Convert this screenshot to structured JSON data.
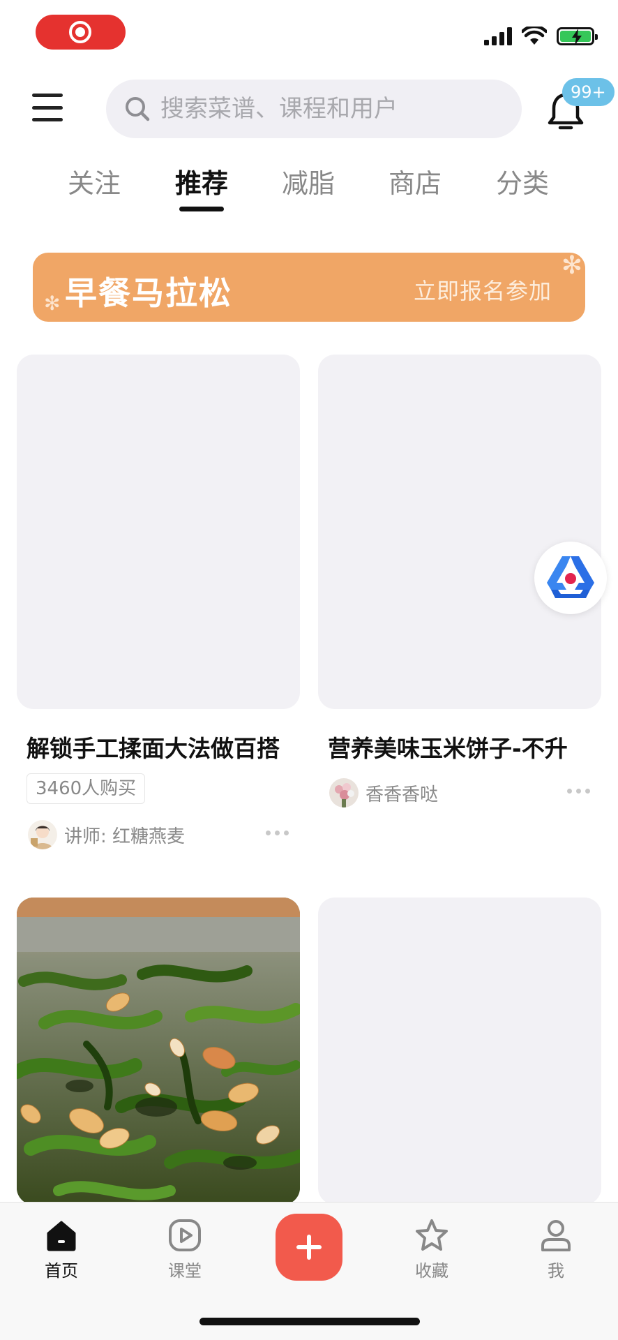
{
  "header": {
    "search_placeholder": "搜索菜谱、课程和用户",
    "notification_badge": "99+"
  },
  "tabs": [
    {
      "label": "关注",
      "active": false
    },
    {
      "label": "推荐",
      "active": true
    },
    {
      "label": "减脂",
      "active": false
    },
    {
      "label": "商店",
      "active": false
    },
    {
      "label": "分类",
      "active": false
    }
  ],
  "banner": {
    "title": "早餐马拉松",
    "cta": "立即报名参加"
  },
  "cards": [
    {
      "title": "解锁手工揉面大法做百搭",
      "tag": "3460人购买",
      "meta": "讲师: 红糖燕麦",
      "image": "placeholder"
    },
    {
      "title": "营养美味玉米饼子-不升",
      "meta": "香香香哒",
      "image": "placeholder"
    },
    {
      "title": "",
      "image": "stir-fried-green-peppers-photo"
    },
    {
      "title": "",
      "image": "placeholder"
    }
  ],
  "tabbar": {
    "items": [
      {
        "label": "首页",
        "icon": "home-icon",
        "active": true
      },
      {
        "label": "课堂",
        "icon": "play-icon",
        "active": false
      },
      {
        "label": "",
        "icon": "plus-icon",
        "active": false
      },
      {
        "label": "收藏",
        "icon": "star-icon",
        "active": false
      },
      {
        "label": "我",
        "icon": "user-icon",
        "active": false
      }
    ]
  },
  "colors": {
    "accent": "#f25a4c",
    "banner": "#f0a666",
    "badge": "#6cc1e8",
    "recording": "#e5322f"
  }
}
